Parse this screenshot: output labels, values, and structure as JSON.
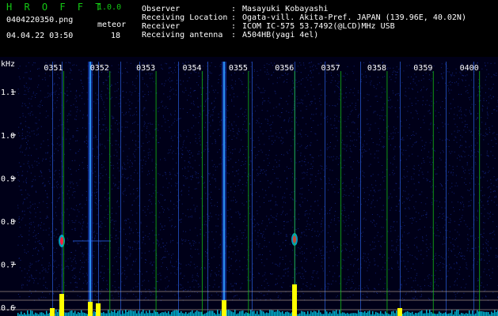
{
  "app": {
    "logo": "H R O F F T",
    "version": "1.0.0",
    "filename": "0404220350.png",
    "datetime": "04.04.22 03:50",
    "meteor_label": "meteor",
    "meteor_count": "18"
  },
  "info": {
    "rows": [
      {
        "label": "Observer",
        "value": "Masayuki Kobayashi"
      },
      {
        "label": "Receiving Location",
        "value": "Ogata-vill. Akita-Pref. JAPAN (139.96E, 40.02N)"
      },
      {
        "label": "Receiver",
        "value": "ICOM IC-575 53.7492(@LCD)MHz USB"
      },
      {
        "label": "Receiving antenna",
        "value": "A504HB(yagi 4el)"
      }
    ]
  },
  "spectrogram": {
    "y_unit": "kHz",
    "y_ticks": [
      "1.1",
      "1.0",
      "0.9",
      "0.8",
      "0.7",
      "0.6"
    ],
    "y_tick_values": [
      1.1,
      1.0,
      0.9,
      0.8,
      0.7,
      0.6
    ],
    "y_range": [
      0.58,
      1.17
    ],
    "x_ticks": [
      "0351",
      "0352",
      "0353",
      "0354",
      "0355",
      "0356",
      "0357",
      "0358",
      "0359",
      "0400"
    ],
    "x_tick_values": [
      1,
      2,
      3,
      4,
      5,
      6,
      7,
      8,
      9,
      10
    ],
    "x_range": [
      0,
      10.4
    ],
    "colors": {
      "background": "#000020",
      "noise": "#1e3cc8",
      "grid": "#14c814",
      "text": "#ffffff",
      "label_green": "#14c814",
      "meteor_core": "#ff2040",
      "trace": "#00e0ff",
      "bar": "#ffff00"
    }
  }
}
